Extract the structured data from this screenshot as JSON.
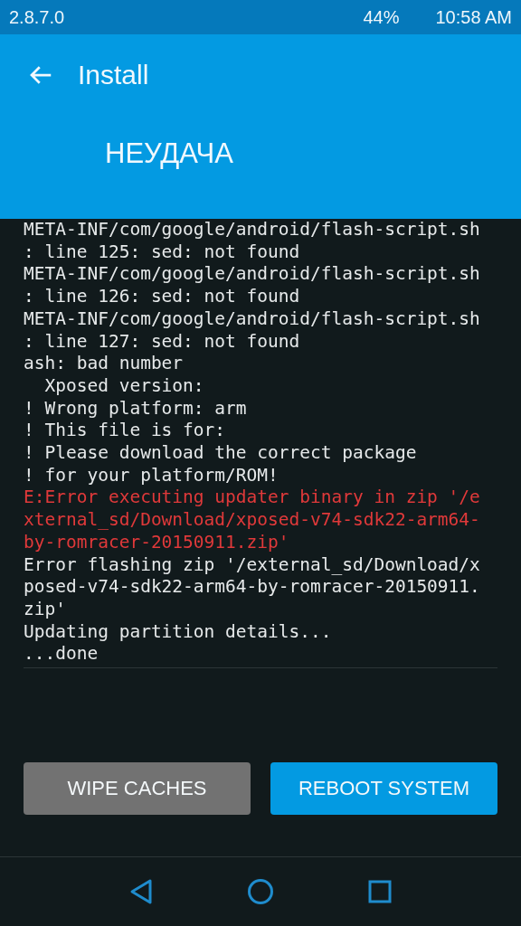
{
  "status_bar": {
    "version": "2.8.7.0",
    "battery": "44%",
    "time": "10:58 AM"
  },
  "header": {
    "title": "Install",
    "status": "НЕУДАЧА"
  },
  "log": [
    {
      "text": "META-INF/com/google/android/flash-script.sh",
      "kind": "normal"
    },
    {
      "text": ": line 125: sed: not found",
      "kind": "normal"
    },
    {
      "text": "META-INF/com/google/android/flash-script.sh",
      "kind": "normal"
    },
    {
      "text": ": line 126: sed: not found",
      "kind": "normal"
    },
    {
      "text": "META-INF/com/google/android/flash-script.sh",
      "kind": "normal"
    },
    {
      "text": ": line 127: sed: not found",
      "kind": "normal"
    },
    {
      "text": "ash: bad number",
      "kind": "normal"
    },
    {
      "text": "  Xposed version:",
      "kind": "normal"
    },
    {
      "text": "! Wrong platform: arm",
      "kind": "normal"
    },
    {
      "text": "! This file is for:",
      "kind": "normal"
    },
    {
      "text": "! Please download the correct package",
      "kind": "normal"
    },
    {
      "text": "! for your platform/ROM!",
      "kind": "normal"
    },
    {
      "text": "E:Error executing updater binary in zip '/e",
      "kind": "error"
    },
    {
      "text": "xternal_sd/Download/xposed-v74-sdk22-arm64-",
      "kind": "error"
    },
    {
      "text": "by-romracer-20150911.zip'",
      "kind": "error"
    },
    {
      "text": "Error flashing zip '/external_sd/Download/x",
      "kind": "normal"
    },
    {
      "text": "posed-v74-sdk22-arm64-by-romracer-20150911.",
      "kind": "normal"
    },
    {
      "text": "zip'",
      "kind": "normal"
    },
    {
      "text": "Updating partition details...",
      "kind": "normal"
    },
    {
      "text": "...done",
      "kind": "normal"
    }
  ],
  "buttons": [
    {
      "label": "WIPE CACHES",
      "kind": "secondary"
    },
    {
      "label": "REBOOT SYSTEM",
      "kind": "primary"
    }
  ]
}
